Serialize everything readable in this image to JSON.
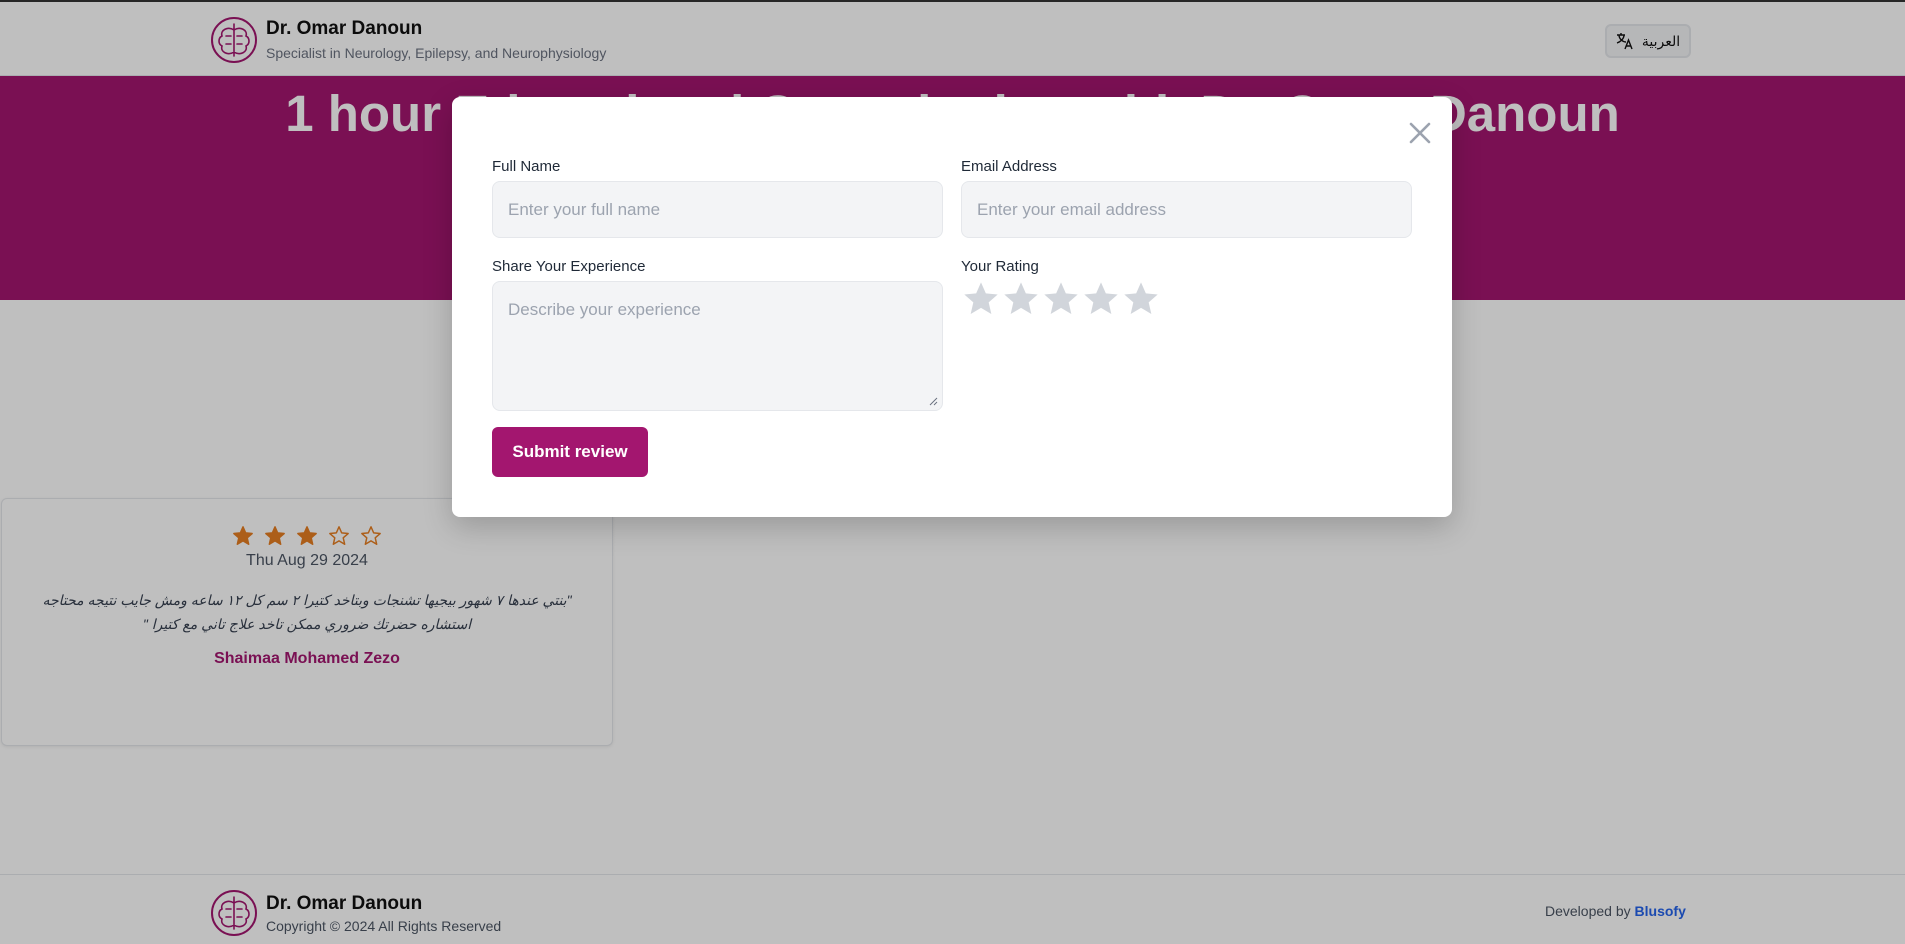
{
  "header": {
    "name": "Dr. Omar Danoun",
    "subtitle": "Specialist in Neurology, Epilepsy, and Neurophysiology",
    "language_button": "العربية"
  },
  "hero": {
    "title": "1 hour Educational Consultation with Dr. Omar Danoun"
  },
  "review": {
    "rating": 3,
    "max_rating": 5,
    "date": "Thu Aug 29 2024",
    "text": "\"بنتي عندها ٧ شهور بيجيها تشنجات وبتاخد كتيرا ٢ سم كل ١٢ ساعه ومش جايب نتيجه محتاجه استشاره حضرتك ضروري ممكن تاخد علاج تاني مع كتيرا \"",
    "author": "Shaimaa Mohamed Zezo"
  },
  "modal": {
    "full_name_label": "Full Name",
    "full_name_placeholder": "Enter your full name",
    "email_label": "Email Address",
    "email_placeholder": "Enter your email address",
    "experience_label": "Share Your Experience",
    "experience_placeholder": "Describe your experience",
    "rating_label": "Your Rating",
    "rating_value": 0,
    "rating_max": 5,
    "submit_label": "Submit review"
  },
  "footer": {
    "name": "Dr. Omar Danoun",
    "copyright": "Copyright © 2024 All Rights Reserved",
    "developed_by": "Developed by",
    "developer": "Blusofy"
  },
  "colors": {
    "brand": "#a3166f",
    "star_filled": "#e67e22",
    "star_empty": "#d1d5db",
    "link": "#2563eb"
  }
}
